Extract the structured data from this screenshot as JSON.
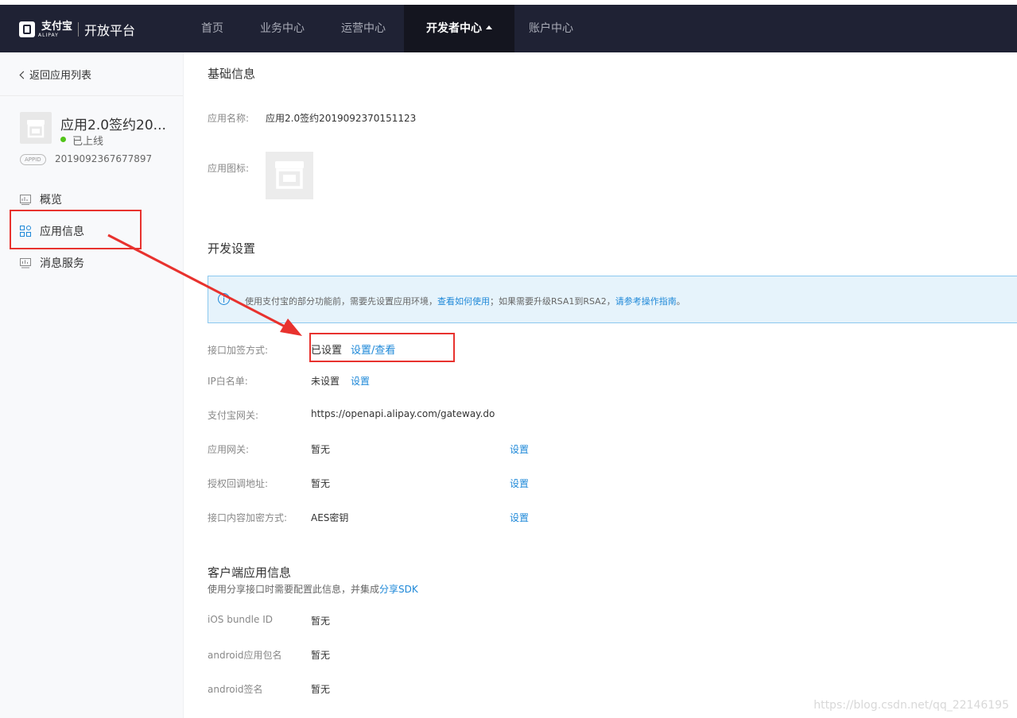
{
  "header": {
    "logo_cn": "支付宝",
    "logo_en": "ALIPAY",
    "platform_title": "开放平台",
    "nav": [
      "首页",
      "业务中心",
      "运营中心",
      "开发者中心",
      "账户中心"
    ]
  },
  "sidebar": {
    "back_label": "返回应用列表",
    "app_name": "应用2.0签约20...",
    "status": "已上线",
    "appid_tag": "APPID",
    "appid": "2019092367677897",
    "menu": [
      "概览",
      "应用信息",
      "消息服务"
    ]
  },
  "basic": {
    "title": "基础信息",
    "name_label": "应用名称:",
    "name_value": "应用2.0签约2019092370151123",
    "icon_label": "应用图标:"
  },
  "dev": {
    "title": "开发设置",
    "notice_prefix": "使用支付宝的部分功能前，需要先设置应用环境，",
    "notice_link1": "查看如何使用",
    "notice_mid": "；如果需要升级RSA1到RSA2，",
    "notice_link2": "请参考操作指南",
    "notice_suffix": "。",
    "rows": [
      {
        "label": "接口加签方式:",
        "value": "已设置",
        "link": "设置/查看"
      },
      {
        "label": "IP白名单:",
        "value": "未设置",
        "link": "设置"
      },
      {
        "label": "支付宝网关:",
        "value": "https://openapi.alipay.com/gateway.do",
        "link": ""
      },
      {
        "label": "应用网关:",
        "value": "暂无",
        "link": "设置"
      },
      {
        "label": "授权回调地址:",
        "value": "暂无",
        "link": "设置"
      },
      {
        "label": "接口内容加密方式:",
        "value": "AES密钥",
        "link": "设置"
      }
    ]
  },
  "client": {
    "title": "客户端应用信息",
    "note_prefix": "使用分享接口时需要配置此信息，并集成",
    "note_link": "分享SDK",
    "rows": [
      {
        "label": "iOS bundle ID",
        "value": "暂无"
      },
      {
        "label": "android应用包名",
        "value": "暂无"
      },
      {
        "label": "android签名",
        "value": "暂无"
      }
    ]
  },
  "watermark": "https://blog.csdn.net/qq_22146195",
  "colors": {
    "nav_bg": "#1f2234",
    "link": "#1e88d8",
    "annotation": "#e8322e",
    "status": "#52c41a"
  }
}
